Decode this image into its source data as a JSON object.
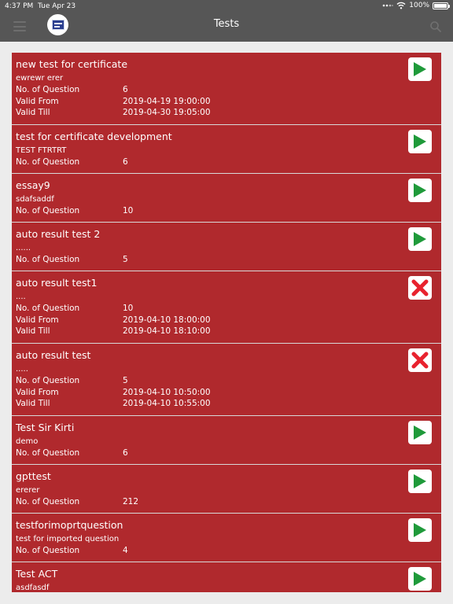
{
  "status": {
    "time": "4:37 PM",
    "date": "Tue Apr 23",
    "battery": "100%"
  },
  "nav": {
    "title": "Tests"
  },
  "labels": {
    "questions": "No. of Question",
    "valid_from": "Valid From",
    "valid_till": "Valid Till"
  },
  "tests": [
    {
      "title": "new test for certificate",
      "desc": "ewrewr erer",
      "questions": "6",
      "valid_from": "2019-04-19 19:00:00",
      "valid_till": "2019-04-30 19:05:00",
      "action": "play"
    },
    {
      "title": "test for certificate development",
      "desc": "TEST FTRTRT",
      "questions": "6",
      "action": "play"
    },
    {
      "title": "essay9",
      "desc": "sdafsaddf",
      "questions": "10",
      "action": "play"
    },
    {
      "title": "auto result test 2",
      "desc": "......",
      "questions": "5",
      "action": "play"
    },
    {
      "title": "auto result test1",
      "desc": "....",
      "questions": "10",
      "valid_from": "2019-04-10 18:00:00",
      "valid_till": "2019-04-10 18:10:00",
      "action": "closed"
    },
    {
      "title": "auto result test",
      "desc": ".....",
      "questions": "5",
      "valid_from": "2019-04-10 10:50:00",
      "valid_till": "2019-04-10 10:55:00",
      "action": "closed"
    },
    {
      "title": "Test Sir Kirti",
      "desc": "demo",
      "questions": "6",
      "action": "play"
    },
    {
      "title": "gpttest",
      "desc": "ererer",
      "questions": "212",
      "action": "play"
    },
    {
      "title": "testforimoprtquestion",
      "desc": "test for imported question",
      "questions": "4",
      "action": "play"
    },
    {
      "title": " Test ACT",
      "desc": "asdfasdf",
      "action": "play"
    }
  ],
  "colors": {
    "card": "#b0292d",
    "play": "#1f9a3a",
    "closed": "#e8222e",
    "navbar": "#565656"
  },
  "icons": {
    "menu": "hamburger-icon",
    "search": "search-icon",
    "logo": "app-logo",
    "play": "play-icon",
    "closed": "close-icon"
  }
}
